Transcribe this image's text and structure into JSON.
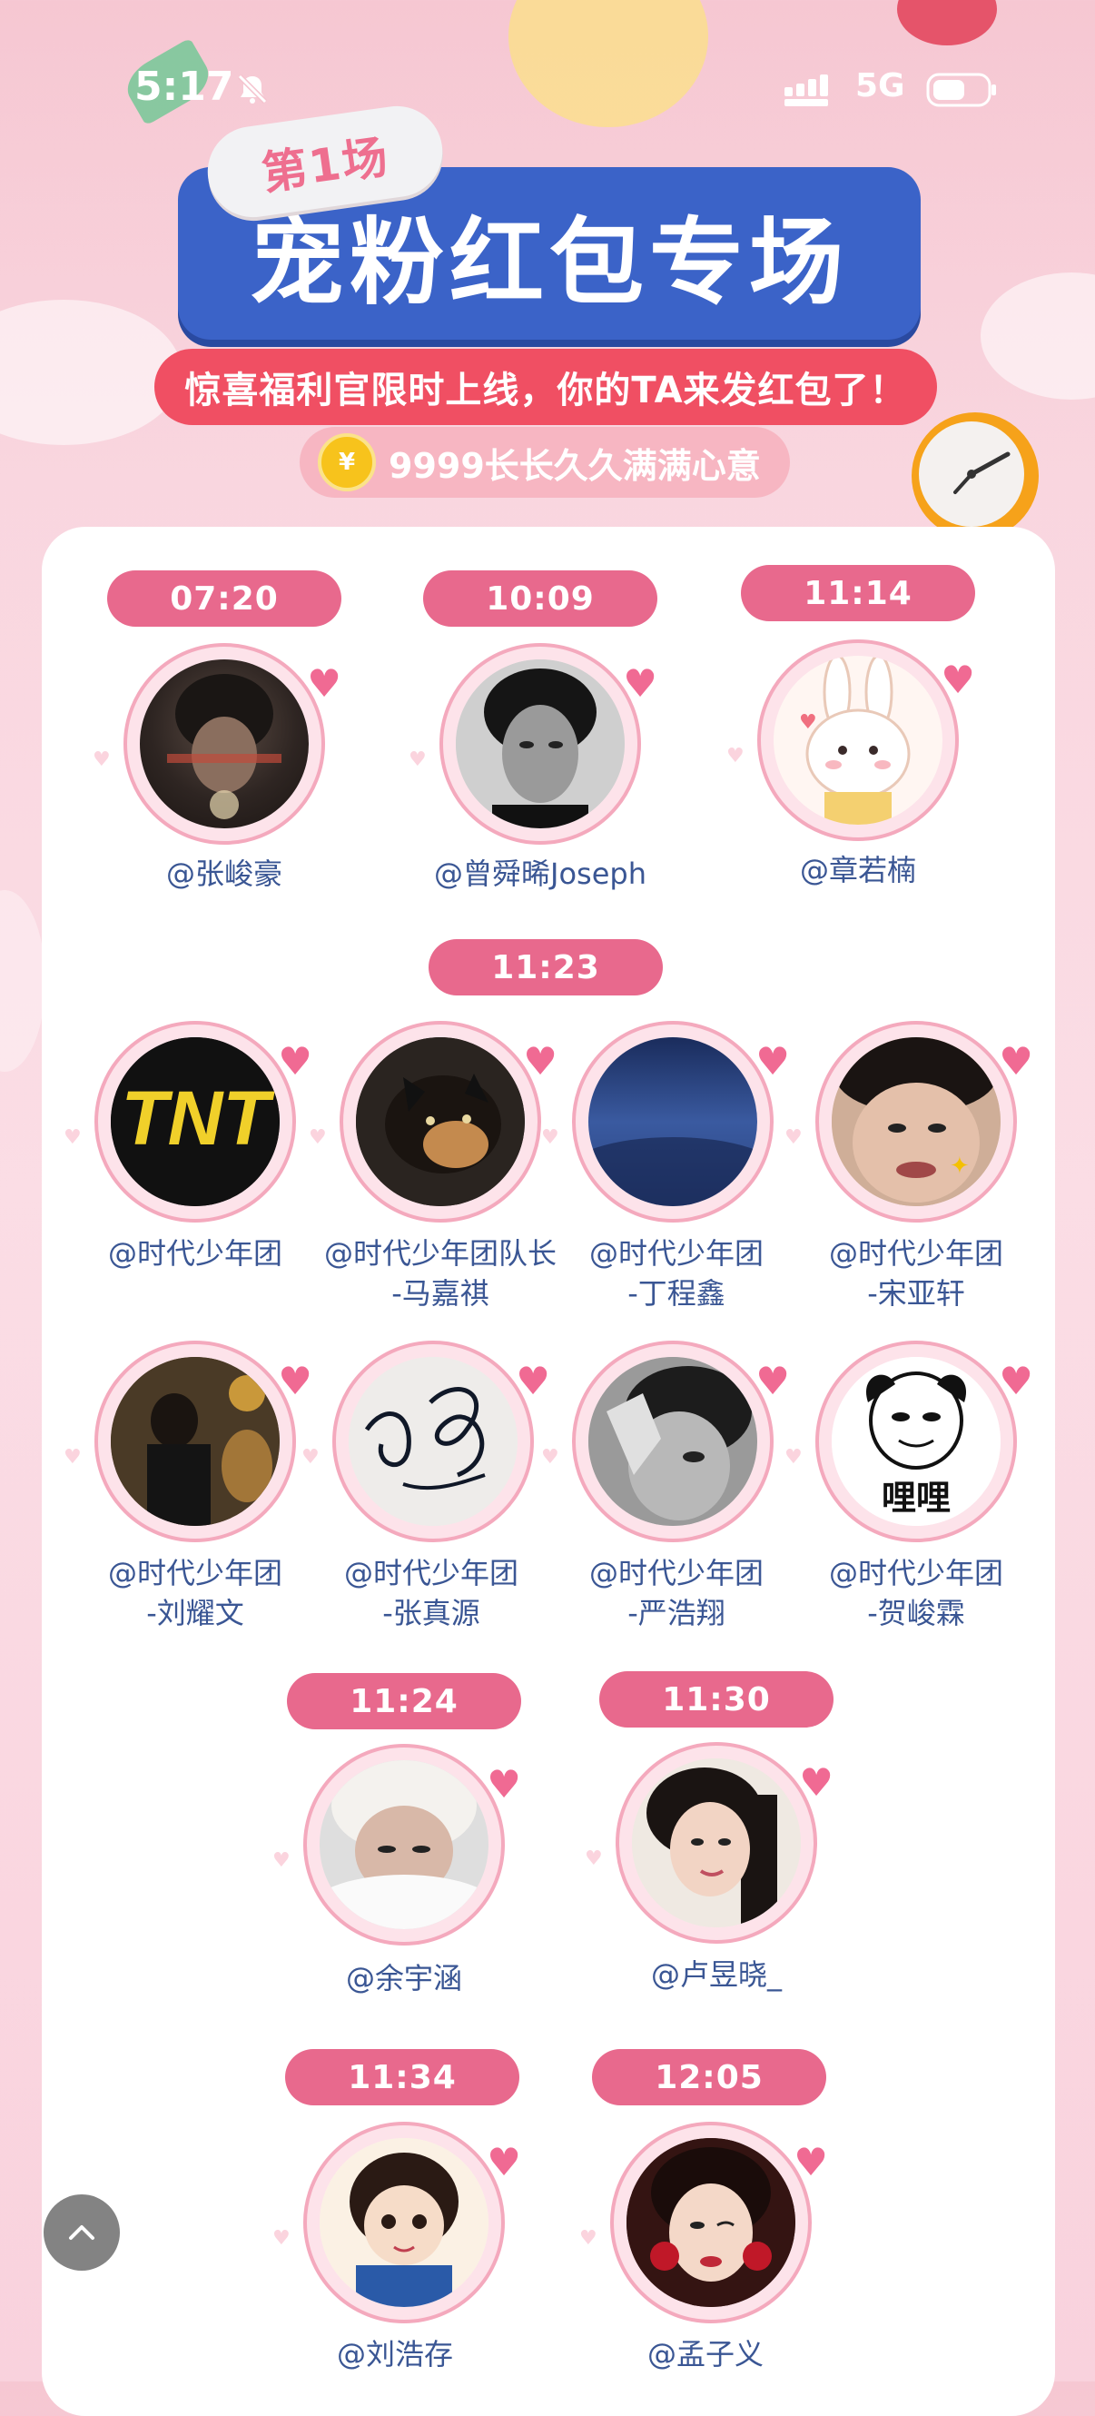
{
  "status_bar": {
    "time": "5:17",
    "network": "5G"
  },
  "header": {
    "badge": "第1场",
    "title": "宠粉红包专场",
    "subtitle": "惊喜福利官限时上线，你的TA来发红包了！",
    "slogan": "9999长长久久满满心意",
    "coin_symbol": "¥"
  },
  "slots": [
    {
      "time": "07:20",
      "users": [
        {
          "name": "@张峻豪"
        }
      ]
    },
    {
      "time": "10:09",
      "users": [
        {
          "name": "@曾舜晞Joseph"
        }
      ]
    },
    {
      "time": "11:14",
      "users": [
        {
          "name": "@章若楠"
        }
      ]
    },
    {
      "time": "11:23",
      "users": [
        {
          "name": "@时代少年团"
        },
        {
          "name": "@时代少年团队长",
          "name2": "-马嘉祺"
        },
        {
          "name": "@时代少年团",
          "name2": "-丁程鑫"
        },
        {
          "name": "@时代少年团",
          "name2": "-宋亚轩"
        },
        {
          "name": "@时代少年团",
          "name2": "-刘耀文"
        },
        {
          "name": "@时代少年团",
          "name2": "-张真源"
        },
        {
          "name": "@时代少年团",
          "name2": "-严浩翔"
        },
        {
          "name": "@时代少年团",
          "name2": "-贺峻霖"
        }
      ]
    },
    {
      "time": "11:24",
      "users": [
        {
          "name": "@余宇涵"
        }
      ]
    },
    {
      "time": "11:30",
      "users": [
        {
          "name": "@卢昱晓_"
        }
      ]
    },
    {
      "time": "11:34",
      "users": [
        {
          "name": "@刘浩存"
        }
      ]
    },
    {
      "time": "12:05",
      "users": [
        {
          "name": "@孟子义"
        }
      ]
    }
  ],
  "avatar_text": {
    "logo": "TNT",
    "meme": "哩哩"
  },
  "colors": {
    "pill": "#e8698d",
    "title_bg": "#3b63c8",
    "banner": "#f04f63",
    "name": "#3a5694"
  }
}
